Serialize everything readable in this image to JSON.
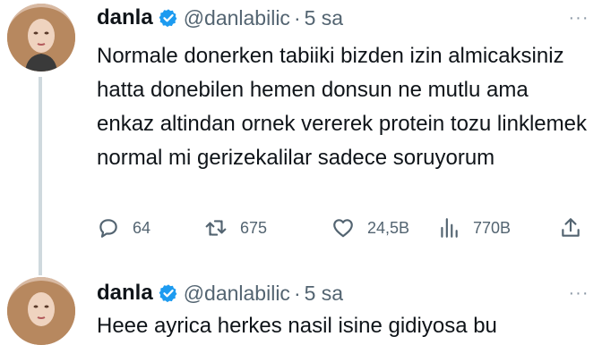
{
  "tweets": [
    {
      "author": {
        "name": "danla",
        "handle": "@danlabilic",
        "separator": "·",
        "time": "5 sa",
        "verified": true
      },
      "text": "Normale donerken tabiiki bizden izin almicaksiniz hatta donebilen hemen donsun ne mutlu ama enkaz altindan ornek vererek protein tozu linklemek normal mi gerizekalilar sadece soruyorum",
      "stats": {
        "replies": "64",
        "retweets": "675",
        "likes": "24,5B",
        "views": "770B"
      },
      "icons": [
        "reply-icon",
        "retweet-icon",
        "like-icon",
        "views-icon",
        "share-icon"
      ]
    },
    {
      "author": {
        "name": "danla",
        "handle": "@danlabilic",
        "separator": "·",
        "time": "5 sa",
        "verified": true
      },
      "text": "Heee ayrica herkes nasil isine gidiyosa bu"
    }
  ],
  "colors": {
    "primary_text": "#0f1419",
    "secondary_text": "#536471",
    "verified_badge": "#1d9bf0",
    "thread_line": "#cfd9de"
  }
}
